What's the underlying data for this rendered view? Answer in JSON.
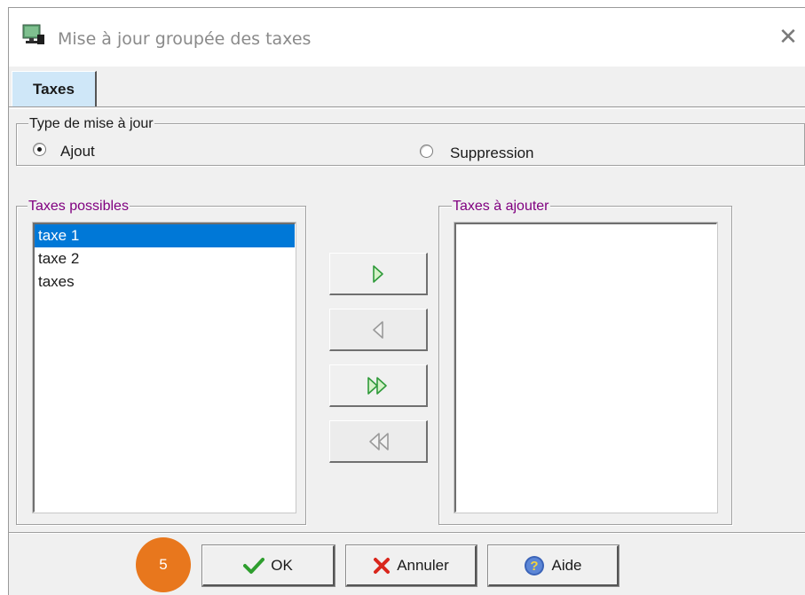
{
  "window": {
    "title": "Mise à jour groupée des taxes",
    "close_glyph": "✕"
  },
  "tabs": [
    {
      "label": "Taxes",
      "active": true
    }
  ],
  "update_type": {
    "legend": "Type de mise à jour",
    "options": [
      {
        "label": "Ajout",
        "selected": true
      },
      {
        "label": "Suppression",
        "selected": false
      }
    ]
  },
  "available": {
    "legend": "Taxes possibles",
    "items": [
      "taxe 1",
      "taxe 2",
      "taxes"
    ],
    "selected_index": 0
  },
  "to_add": {
    "legend": "Taxes à ajouter",
    "items": []
  },
  "transfer_buttons": [
    {
      "name": "add-selected",
      "icon": "arrow-right-icon",
      "enabled": true
    },
    {
      "name": "remove-selected",
      "icon": "arrow-left-icon",
      "enabled": false
    },
    {
      "name": "add-all",
      "icon": "double-arrow-right-icon",
      "enabled": true
    },
    {
      "name": "remove-all",
      "icon": "double-arrow-left-icon",
      "enabled": false
    }
  ],
  "footer": {
    "ok_label": "OK",
    "cancel_label": "Annuler",
    "help_label": "Aide"
  },
  "step_badge": "5",
  "colors": {
    "selection": "#0078d7",
    "tab_active": "#cfe7f8",
    "legend_purple": "#800080",
    "badge_orange": "#e8771d",
    "ok_check": "#2e9e2e",
    "cancel_x": "#d9261c",
    "help_blue": "#3a63b8"
  }
}
